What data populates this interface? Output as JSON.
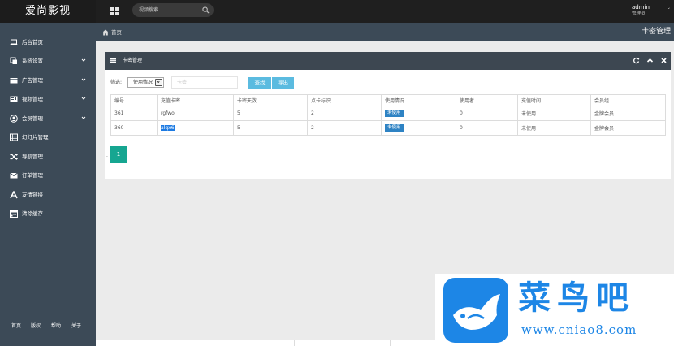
{
  "app": {
    "logo": "爱尚影视"
  },
  "header": {
    "search_placeholder": "视频搜索",
    "user_name": "admin",
    "user_role": "管理员"
  },
  "sidebar": {
    "items": [
      {
        "label": "后台首页",
        "icon": "laptop-icon",
        "has_children": false
      },
      {
        "label": "系统设置",
        "icon": "settings-icon",
        "has_children": true
      },
      {
        "label": "广告管理",
        "icon": "credit-card-icon",
        "has_children": true
      },
      {
        "label": "视频管理",
        "icon": "video-icon",
        "has_children": true
      },
      {
        "label": "会员管理",
        "icon": "user-icon",
        "has_children": true
      },
      {
        "label": "幻灯片管理",
        "icon": "grid-icon",
        "has_children": false
      },
      {
        "label": "导航管理",
        "icon": "shuffle-icon",
        "has_children": false
      },
      {
        "label": "订单管理",
        "icon": "envelope-icon",
        "has_children": false
      },
      {
        "label": "友情链接",
        "icon": "font-icon",
        "has_children": false
      },
      {
        "label": "清除缓存",
        "icon": "calendar-icon",
        "has_children": false
      }
    ],
    "footer_links": [
      "首页",
      "版权",
      "帮助",
      "关于"
    ]
  },
  "breadcrumb": {
    "home": "首页",
    "page_title": "卡密管理"
  },
  "panel": {
    "title": "卡密管理",
    "filter_label": "筛选:",
    "filter_select_value": "使用情况",
    "filter_input_placeholder": "卡密",
    "search_button": "查找",
    "export_button": "导出",
    "columns": [
      "编号",
      "充值卡密",
      "卡密天数",
      "点卡标识",
      "使用情况",
      "使用者",
      "充值时间",
      "会员组"
    ],
    "rows": [
      {
        "id": "361",
        "card": "rgfwo",
        "days": "5",
        "mark": "2",
        "status": "未使用",
        "user": "0",
        "time": "未使用",
        "group": "金牌会员"
      },
      {
        "id": "360",
        "card": "alqx6",
        "days": "5",
        "mark": "2",
        "status": "未使用",
        "user": "0",
        "time": "未使用",
        "group": "金牌会员"
      }
    ]
  },
  "pagination": {
    "current": "1"
  },
  "watermark": {
    "text": "菜鸟吧",
    "url": "www.cniao8.com"
  },
  "colors": {
    "topbar": "#1f1f1f",
    "sidebar": "#3c4a57",
    "panel_header": "#3d4751",
    "button": "#5bbbe0",
    "badge": "#2e83c4",
    "pager": "#16a691",
    "watermark": "#1d86e6"
  }
}
